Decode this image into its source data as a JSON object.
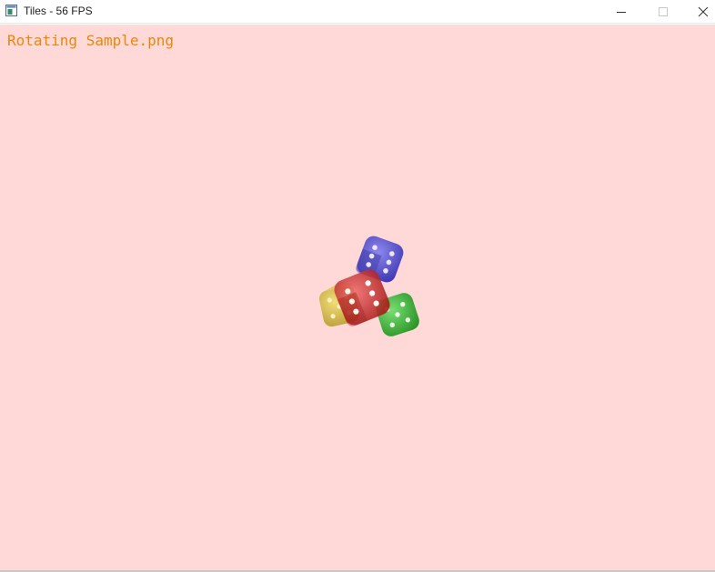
{
  "window": {
    "title": "Tiles - 56 FPS",
    "controls": [
      "minimize",
      "maximize",
      "close"
    ]
  },
  "canvas": {
    "background": "#ffd8d8",
    "overlay_text": "Rotating Sample.png",
    "overlay_color": "#e8870a"
  },
  "dice": [
    {
      "name": "yellow-die",
      "color": "#c9b61a"
    },
    {
      "name": "blue-die",
      "color": "#3a3ad6"
    },
    {
      "name": "green-die",
      "color": "#1fb21f"
    },
    {
      "name": "red-die",
      "color": "#d02828"
    }
  ],
  "icons": {
    "app": "window-app-icon",
    "minimize": "minimize-icon",
    "maximize": "maximize-icon",
    "close": "close-icon"
  }
}
